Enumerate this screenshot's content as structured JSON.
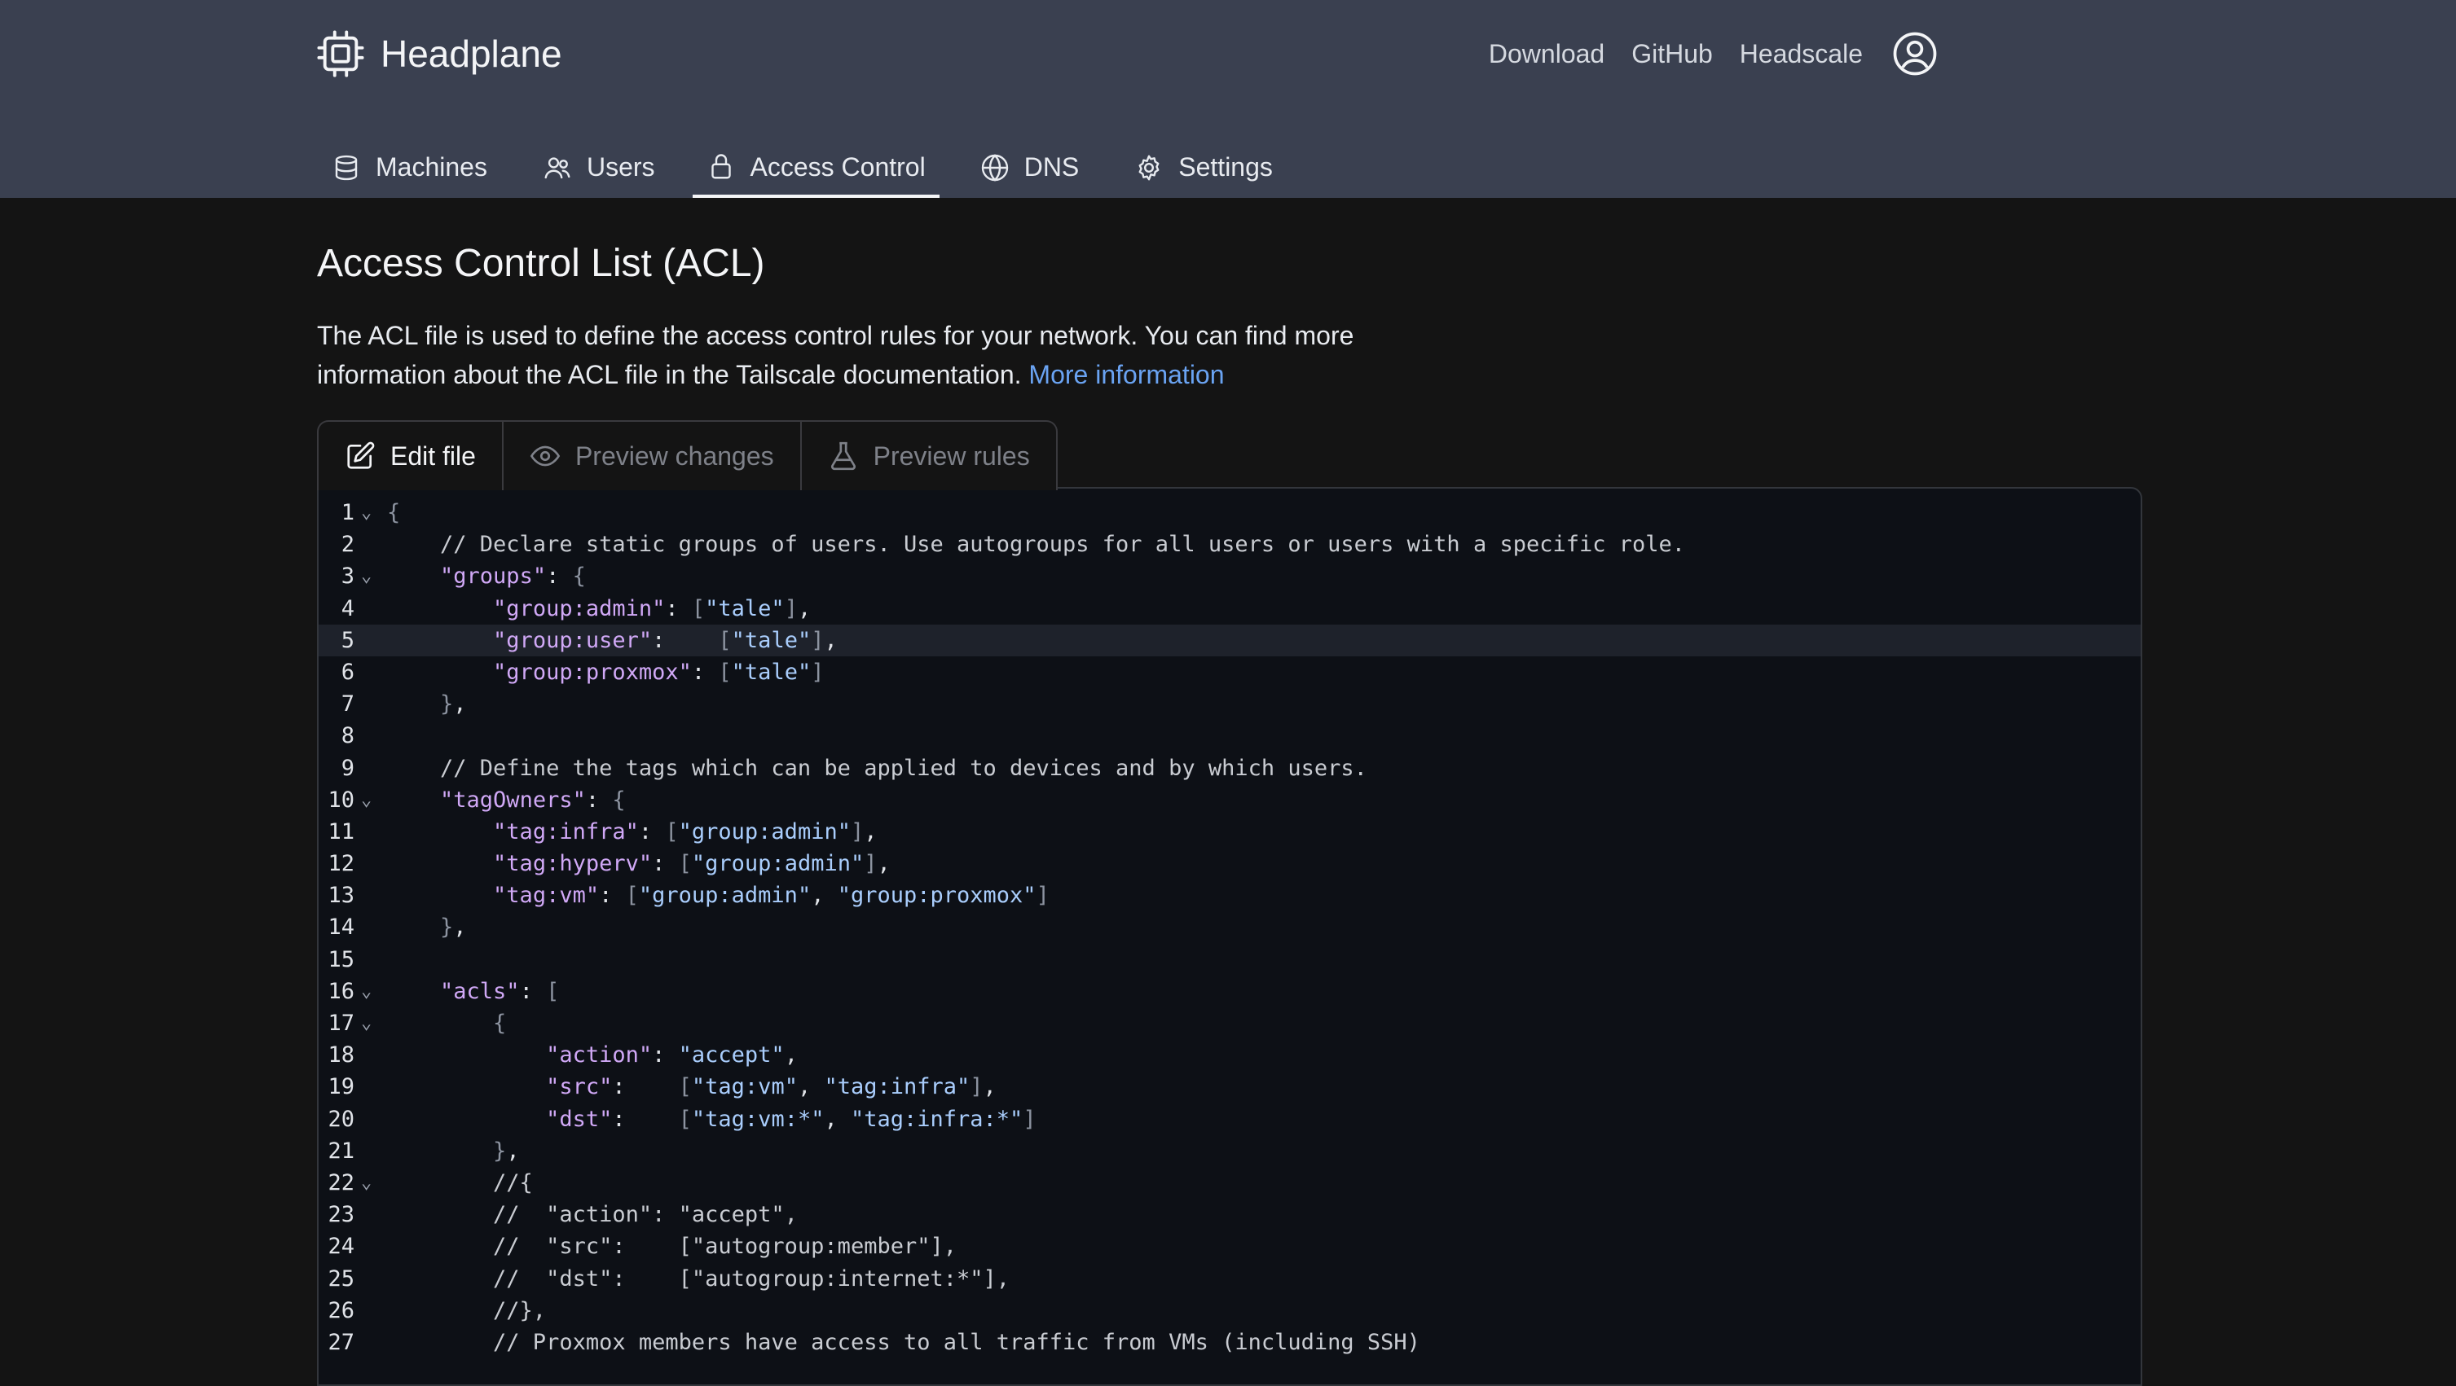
{
  "app": {
    "title": "Headplane"
  },
  "topnav": {
    "links": [
      "Download",
      "GitHub",
      "Headscale"
    ]
  },
  "tabs": [
    {
      "label": "Machines",
      "icon": "server-icon"
    },
    {
      "label": "Users",
      "icon": "users-icon"
    },
    {
      "label": "Access Control",
      "icon": "lock-icon",
      "active": true
    },
    {
      "label": "DNS",
      "icon": "globe-icon"
    },
    {
      "label": "Settings",
      "icon": "gear-icon"
    }
  ],
  "page": {
    "title": "Access Control List (ACL)",
    "description": "The ACL file is used to define the access control rules for your network. You can find more information about the ACL file in the Tailscale documentation.",
    "more_link": "More information"
  },
  "editor_tabs": [
    {
      "label": "Edit file",
      "icon": "pencil-icon",
      "active": true
    },
    {
      "label": "Preview changes",
      "icon": "eye-icon"
    },
    {
      "label": "Preview rules",
      "icon": "flask-icon"
    }
  ],
  "editor": {
    "active_line": 5,
    "lines": [
      "{",
      "    // Declare static groups of users. Use autogroups for all users or users with a specific role.",
      "    \"groups\": {",
      "        \"group:admin\": [\"tale\"],",
      "        \"group:user\":    [\"tale\"],",
      "        \"group:proxmox\": [\"tale\"]",
      "    },",
      "",
      "    // Define the tags which can be applied to devices and by which users.",
      "    \"tagOwners\": {",
      "        \"tag:infra\": [\"group:admin\"],",
      "        \"tag:hyperv\": [\"group:admin\"],",
      "        \"tag:vm\": [\"group:admin\", \"group:proxmox\"]",
      "    },",
      "",
      "    \"acls\": [",
      "        {",
      "            \"action\": \"accept\",",
      "            \"src\":    [\"tag:vm\", \"tag:infra\"],",
      "            \"dst\":    [\"tag:vm:*\", \"tag:infra:*\"]",
      "        },",
      "        //{",
      "        //  \"action\": \"accept\",",
      "        //  \"src\":    [\"autogroup:member\"],",
      "        //  \"dst\":    [\"autogroup:internet:*\"],",
      "        //},",
      "        // Proxmox members have access to all traffic from VMs (including SSH)"
    ],
    "fold_lines": [
      1,
      3,
      10,
      16,
      17,
      22
    ]
  }
}
